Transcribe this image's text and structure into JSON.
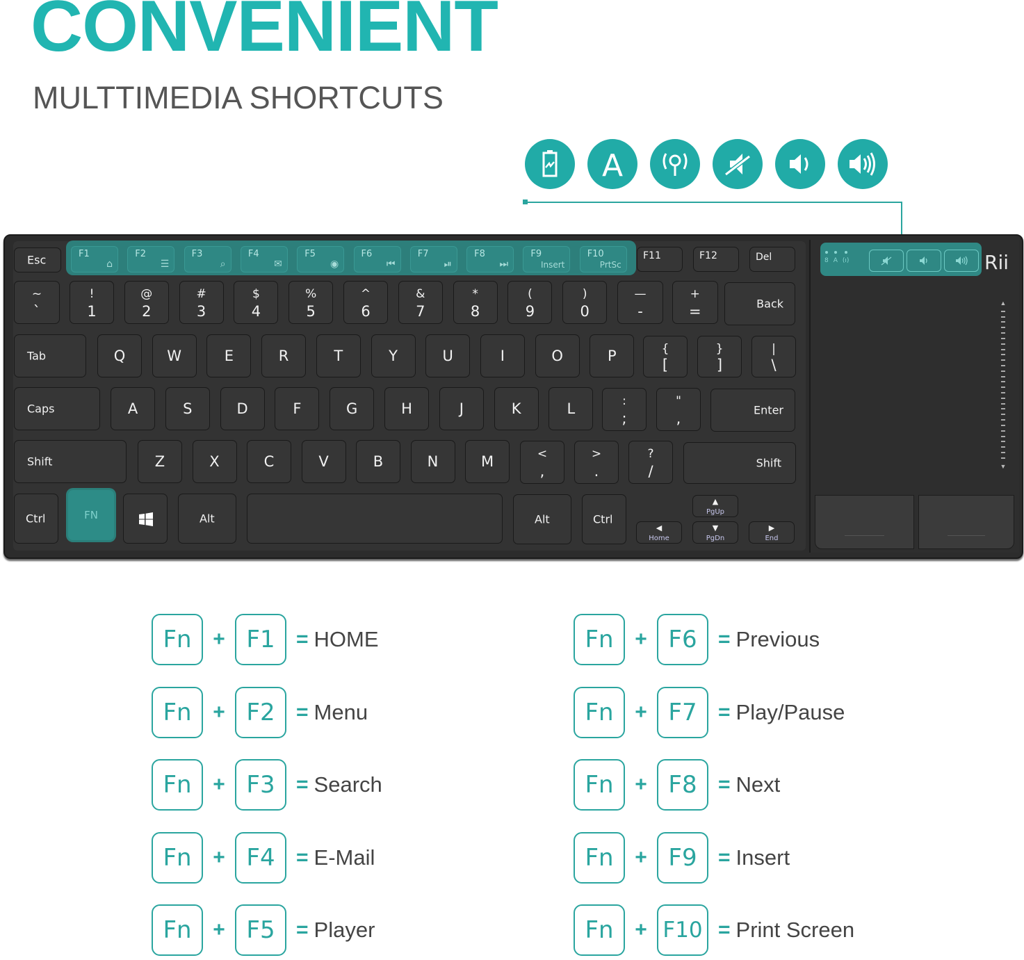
{
  "header": {
    "title": "CONVENIENT",
    "subtitle": "MULTTIMEDIA SHORTCUTS"
  },
  "indicator_icons": [
    "battery-charging-icon",
    "caps-lock-icon",
    "wireless-signal-icon",
    "mute-icon",
    "volume-down-icon",
    "volume-up-icon"
  ],
  "indicator_letter": "A",
  "keyboard": {
    "esc": "Esc",
    "fkeys": [
      {
        "label": "F1",
        "icon": "home-icon",
        "glyph": "⌂"
      },
      {
        "label": "F2",
        "icon": "menu-icon",
        "glyph": "☰"
      },
      {
        "label": "F3",
        "icon": "search-icon",
        "glyph": "⌕"
      },
      {
        "label": "F4",
        "icon": "mail-icon",
        "glyph": "✉"
      },
      {
        "label": "F5",
        "icon": "player-icon",
        "glyph": "◉"
      },
      {
        "label": "F6",
        "icon": "previous-icon",
        "glyph": "⏮"
      },
      {
        "label": "F7",
        "icon": "play-pause-icon",
        "glyph": "⏯"
      },
      {
        "label": "F8",
        "icon": "next-icon",
        "glyph": "⏭"
      },
      {
        "label": "F9",
        "icon": "insert-label",
        "glyph": "Insert"
      },
      {
        "label": "F10",
        "icon": "prtsc-label",
        "glyph": "PrtSc"
      }
    ],
    "f11": "F11",
    "f12": "F12",
    "del": "Del",
    "number_row": [
      {
        "up": "~",
        "dn": "`"
      },
      {
        "up": "!",
        "dn": "1"
      },
      {
        "up": "@",
        "dn": "2"
      },
      {
        "up": "#",
        "dn": "3"
      },
      {
        "up": "$",
        "dn": "4"
      },
      {
        "up": "%",
        "dn": "5"
      },
      {
        "up": "^",
        "dn": "6"
      },
      {
        "up": "&",
        "dn": "7"
      },
      {
        "up": "*",
        "dn": "8"
      },
      {
        "up": "(",
        "dn": "9"
      },
      {
        "up": ")",
        "dn": "0"
      },
      {
        "up": "—",
        "dn": "-"
      },
      {
        "up": "+",
        "dn": "="
      }
    ],
    "back": "Back",
    "tab": "Tab",
    "qrow": [
      "Q",
      "W",
      "E",
      "R",
      "T",
      "Y",
      "U",
      "I",
      "O",
      "P"
    ],
    "qrow_sym": [
      {
        "up": "{",
        "dn": "["
      },
      {
        "up": "}",
        "dn": "]"
      },
      {
        "up": "|",
        "dn": "\\"
      }
    ],
    "caps": "Caps",
    "arow": [
      "A",
      "S",
      "D",
      "F",
      "G",
      "H",
      "J",
      "K",
      "L"
    ],
    "arow_sym": [
      {
        "up": ":",
        "dn": ";"
      },
      {
        "up": "\"",
        "dn": ","
      }
    ],
    "enter": "Enter",
    "shift": "Shift",
    "zrow": [
      "Z",
      "X",
      "C",
      "V",
      "B",
      "N",
      "M"
    ],
    "zrow_sym": [
      {
        "up": "<",
        "dn": ","
      },
      {
        "up": ">",
        "dn": "."
      },
      {
        "up": "?",
        "dn": "/"
      }
    ],
    "ctrl": "Ctrl",
    "fn": "FN",
    "alt": "Alt",
    "pgup": "PgUp",
    "pgdn": "PgDn",
    "home": "Home",
    "end": "End"
  },
  "touchpad": {
    "leds": [
      "8",
      "A",
      "(ı)"
    ],
    "buttons": [
      "mute-icon",
      "volume-down-icon",
      "volume-up-icon"
    ],
    "brand": "Rii"
  },
  "shortcuts": [
    {
      "mod": "Fn",
      "key": "F1",
      "action": "HOME"
    },
    {
      "mod": "Fn",
      "key": "F2",
      "action": "Menu"
    },
    {
      "mod": "Fn",
      "key": "F3",
      "action": "Search"
    },
    {
      "mod": "Fn",
      "key": "F4",
      "action": "E-Mail"
    },
    {
      "mod": "Fn",
      "key": "F5",
      "action": "Player"
    },
    {
      "mod": "Fn",
      "key": "F6",
      "action": "Previous"
    },
    {
      "mod": "Fn",
      "key": "F7",
      "action": "Play/Pause"
    },
    {
      "mod": "Fn",
      "key": "F8",
      "action": "Next"
    },
    {
      "mod": "Fn",
      "key": "F9",
      "action": "Insert"
    },
    {
      "mod": "Fn",
      "key": "F10",
      "action": "Print Screen"
    }
  ],
  "shortcut_plus": "+",
  "shortcut_eq": "=",
  "colors": {
    "accent": "#21b5b1",
    "keyboard": "#333333",
    "text": "#444444"
  }
}
